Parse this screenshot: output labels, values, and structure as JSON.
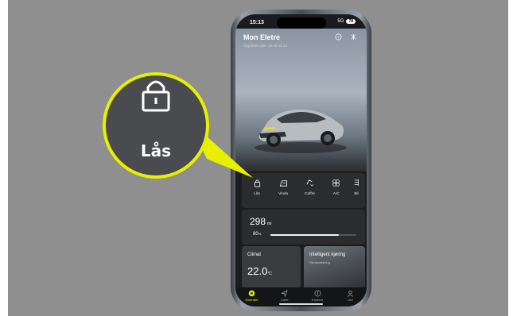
{
  "status_bar": {
    "time": "15:13",
    "network": "5G",
    "battery": "78"
  },
  "header": {
    "title": "Mon Eletre",
    "subtitle": "Oppdatert den. 29.08 15:13"
  },
  "icons": {
    "help": "help-circle-icon",
    "fan": "fan-icon"
  },
  "quick_actions": [
    {
      "label": "Lås",
      "icon": "lock-icon"
    },
    {
      "label": "Vindu",
      "icon": "window-icon"
    },
    {
      "label": "Coffre",
      "icon": "trunk-icon"
    },
    {
      "label": "A/C",
      "icon": "ac-fan-icon"
    },
    {
      "label": "Bli",
      "icon": "lights-icon"
    }
  ],
  "range": {
    "value": "298",
    "unit": "mi",
    "percent": "80",
    "percent_unit": "%",
    "fill_fraction": 0.8
  },
  "tiles": {
    "climate": {
      "label": "Climat",
      "value": "22.0",
      "unit": "°C"
    },
    "driving": {
      "label": "Intelligent kjøring",
      "sub": "Fjernparkering"
    }
  },
  "tabs": [
    {
      "label": "Kontroller",
      "icon": "steering-icon",
      "active": true
    },
    {
      "label": "Carte",
      "icon": "navigation-icon",
      "active": false
    },
    {
      "label": "Explorer",
      "icon": "compass-icon",
      "active": false
    },
    {
      "label": "Moi",
      "icon": "person-icon",
      "active": false
    }
  ],
  "callout": {
    "label": "Lås",
    "icon": "lock-icon"
  },
  "colors": {
    "accent": "#e7f000",
    "callout_fill": "#4a4b4e",
    "background": "#8f8f8f"
  }
}
